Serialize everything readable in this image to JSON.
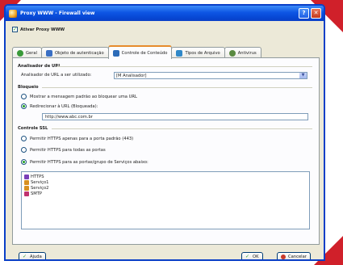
{
  "window": {
    "title": "Proxy WWW - Firewall view"
  },
  "enable_proxy": {
    "label": "Ativar Proxy WWW",
    "checked": true
  },
  "tabs": [
    {
      "label": "Geral",
      "icon": "globe-icon",
      "color": "#3a9a3a"
    },
    {
      "label": "Objeto de autenticação",
      "icon": "users-icon",
      "color": "#3a6fc4"
    },
    {
      "label": "Controle de Conteúdo",
      "icon": "funnel-icon",
      "color": "#2c6bb8"
    },
    {
      "label": "Tipos de Arquivo",
      "icon": "file-types-icon",
      "color": "#3088c8"
    },
    {
      "label": "Antivirus",
      "icon": "antivirus-icon",
      "color": "#5a8a40"
    }
  ],
  "url_analyzer": {
    "section": "Analisador de URL",
    "label": "Analisador de URL a ser utilizado:",
    "selected": "[M Analisador]"
  },
  "blocking": {
    "section": "Bloqueio",
    "option1": "Mostrar a mensagem padrão ao bloquear uma URL",
    "option2": "Redirecionar à URL (Bloqueada):",
    "redirect_url": "http://www.abc.com.br"
  },
  "ssl": {
    "section": "Controle SSL",
    "option1": "Permitir HTTPS apenas para a porta padrão (443)",
    "option2": "Permitir HTTPS para todas as portas",
    "option3": "Permitir HTTPS para as portas/grupo de Serviços abaixo:",
    "services": [
      {
        "label": "HTTPS",
        "color": "#7b3fb8"
      },
      {
        "label": "Serviço1",
        "color": "#d89020"
      },
      {
        "label": "Serviço2",
        "color": "#d89020"
      },
      {
        "label": "SMTP",
        "color": "#c0336f"
      }
    ]
  },
  "buttons": {
    "help": "Ajuda",
    "ok": "OK",
    "cancel": "Cancelar"
  }
}
